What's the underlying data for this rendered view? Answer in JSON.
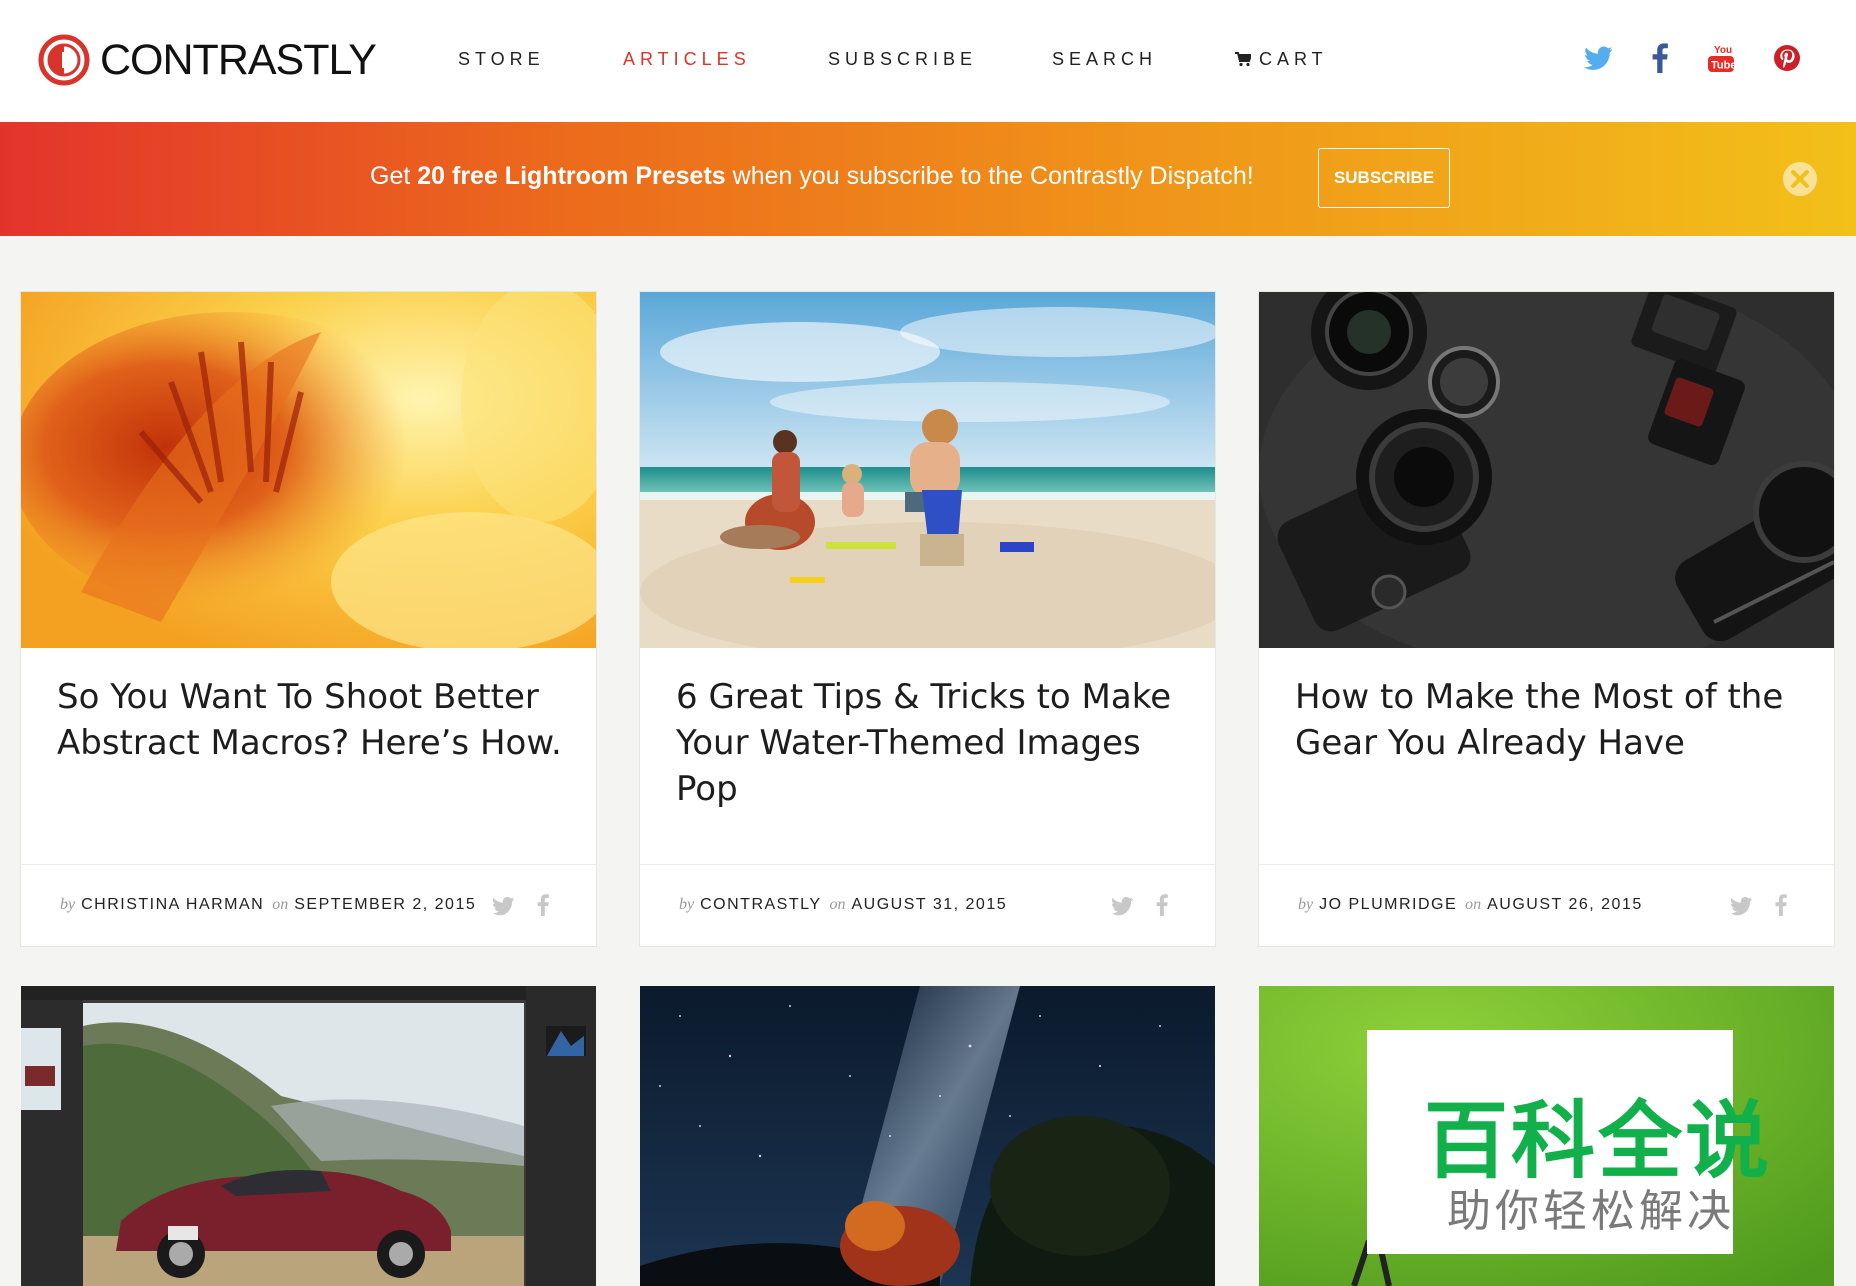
{
  "brand": {
    "name": "CONTRASTLY",
    "accent_color": "#d9342b"
  },
  "nav": {
    "items": [
      {
        "label": "STORE",
        "active": false
      },
      {
        "label": "ARTICLES",
        "active": true
      },
      {
        "label": "SUBSCRIBE",
        "active": false
      },
      {
        "label": "SEARCH",
        "active": false
      },
      {
        "label": "CART",
        "active": false,
        "icon": "cart-icon"
      }
    ]
  },
  "social": [
    {
      "name": "twitter-icon",
      "color": "#55acee"
    },
    {
      "name": "facebook-icon",
      "color": "#3b5998"
    },
    {
      "name": "youtube-icon",
      "color": "#e52d27"
    },
    {
      "name": "pinterest-icon",
      "color": "#cb2027"
    }
  ],
  "banner": {
    "text_before": "Get ",
    "text_bold": "20 free Lightroom Presets",
    "text_after": " when you subscribe to the Contrastly Dispatch!",
    "button_label": "SUBSCRIBE",
    "close_icon": "close-icon"
  },
  "articles": [
    {
      "title": "So You Want To Shoot Better Abstract Macros? Here’s How.",
      "by_label": "by",
      "author": "CHRISTINA HARMAN",
      "on_label": "on",
      "date": "SEPTEMBER 2, 2015",
      "image": "abstract-macro-flower-image"
    },
    {
      "title": "6 Great Tips & Tricks to Make Your Water-Themed Images Pop",
      "by_label": "by",
      "author": "CONTRASTLY",
      "on_label": "on",
      "date": "AUGUST 31, 2015",
      "image": "beach-children-image"
    },
    {
      "title": "How to Make the Most of the Gear You Already Have",
      "by_label": "by",
      "author": "JO PLUMRIDGE",
      "on_label": "on",
      "date": "AUGUST 26, 2015",
      "image": "camera-gear-image"
    }
  ],
  "second_row": [
    {
      "image": "lightroom-car-image"
    },
    {
      "image": "milky-way-night-image"
    },
    {
      "image": "green-screen-image"
    }
  ],
  "watermark": {
    "main": "百科全说",
    "sub": "助你轻松解决"
  }
}
